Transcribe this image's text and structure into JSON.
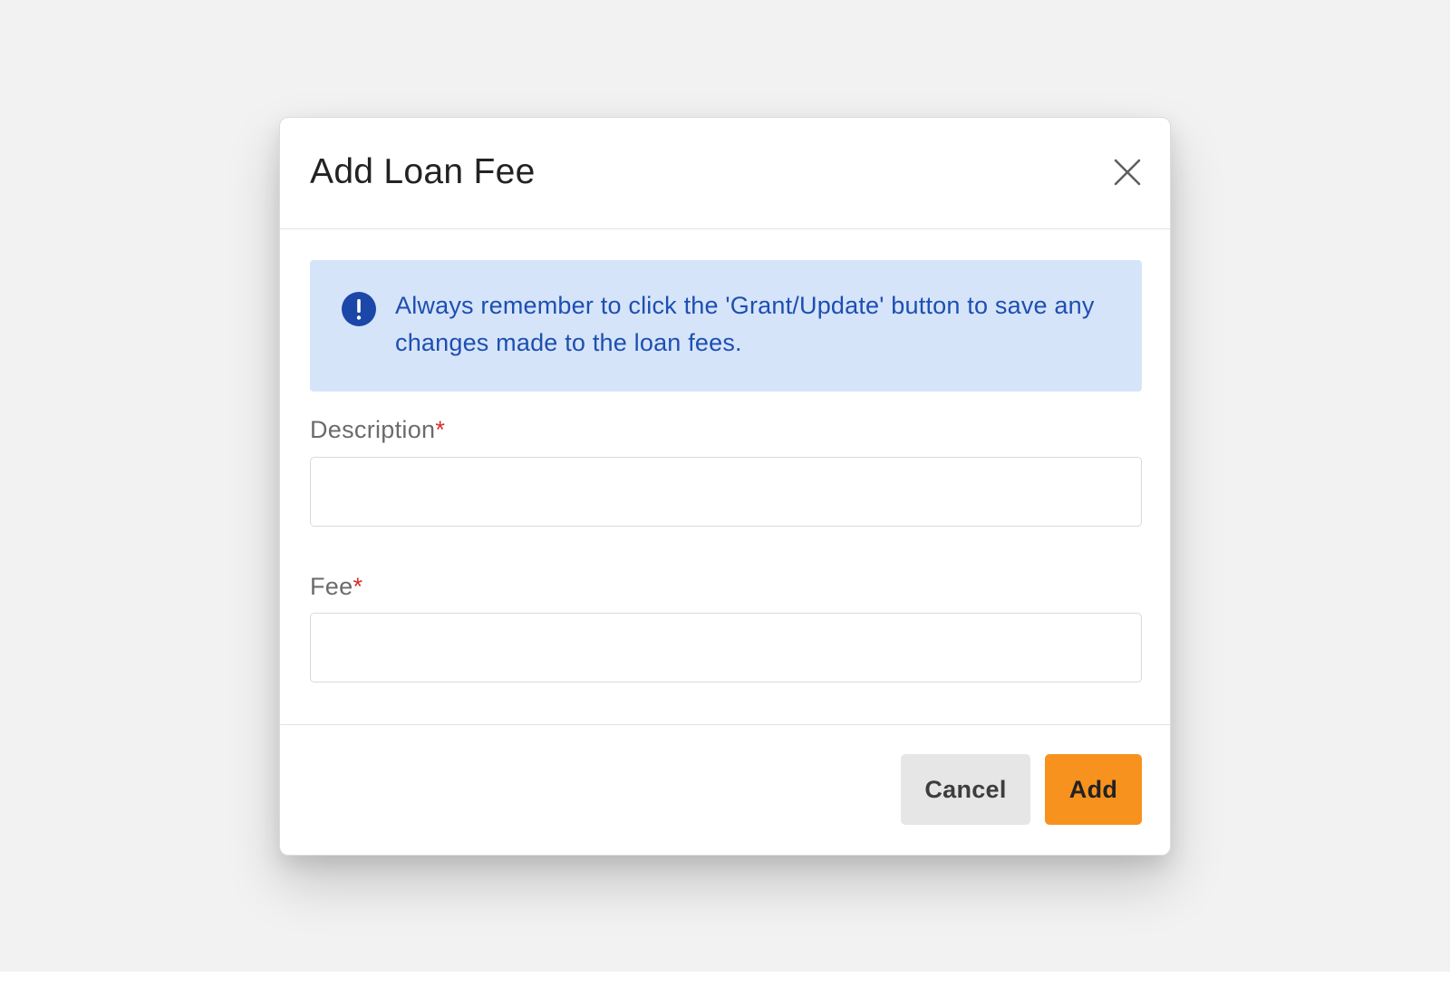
{
  "modal": {
    "title": "Add Loan Fee",
    "close_icon": "close-icon"
  },
  "alert": {
    "icon": "exclamation-circle-icon",
    "message": "Always remember to click the 'Grant/Update' button to save any changes made to the loan fees.",
    "background_color": "#d6e4fa",
    "text_color": "#1d4fb0"
  },
  "form": {
    "description": {
      "label": "Description",
      "required_marker": "*",
      "value": ""
    },
    "fee": {
      "label": "Fee",
      "required_marker": "*",
      "value": ""
    }
  },
  "footer": {
    "cancel_label": "Cancel",
    "add_label": "Add",
    "add_color": "#f7921e"
  }
}
